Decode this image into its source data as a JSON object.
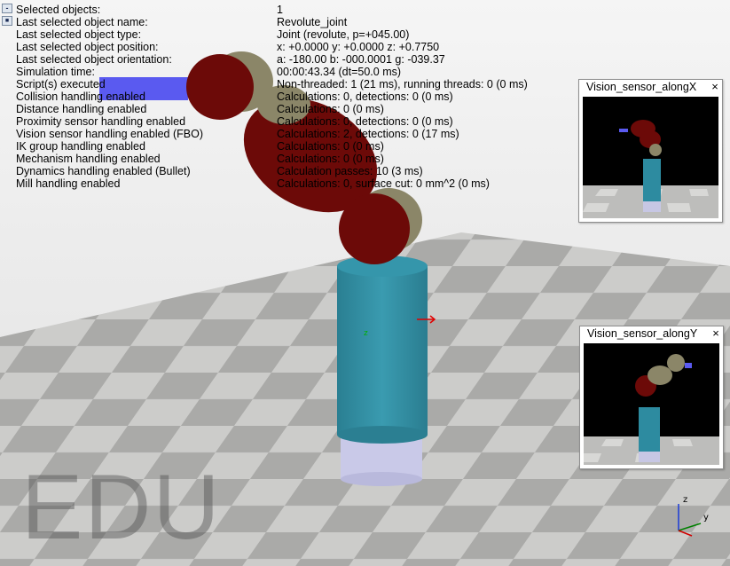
{
  "scene": {
    "watermark": "EDU",
    "gizmo": {
      "x_label": "y",
      "z_label": "z",
      "local_label": "z"
    },
    "colors": {
      "floor_light": "#c4c4c2",
      "floor_dark": "#9e9e9c",
      "base_cylinder": "#2f8a9e",
      "base_ring": "#c8c8e6",
      "joint_maroon": "#6e0a08",
      "joint_cap": "#8a8668",
      "sky": "#000000",
      "marker_blue": "#5858ee"
    }
  },
  "info": {
    "rows": [
      {
        "label": "Selected objects:",
        "value": "1"
      },
      {
        "label": "Last selected object name:",
        "value": "Revolute_joint"
      },
      {
        "label": "Last selected object type:",
        "value": "Joint (revolute, p=+045.00)"
      },
      {
        "label": "Last selected object position:",
        "value": "x: +0.0000    y: +0.0000    z: +0.7750"
      },
      {
        "label": "Last selected object orientation:",
        "value": "a: -180.00    b: -000.0001    g: -039.37"
      },
      {
        "label": "Simulation time:",
        "value": "00:00:43.34 (dt=50.0 ms)"
      },
      {
        "label": "Script(s) executed",
        "value": "Non-threaded: 1 (21 ms), running threads: 0 (0 ms)"
      },
      {
        "label": "Collision handling enabled",
        "value": "Calculations: 0, detections: 0 (0 ms)"
      },
      {
        "label": "Distance handling enabled",
        "value": "Calculations: 0 (0 ms)"
      },
      {
        "label": "Proximity sensor handling enabled",
        "value": "Calculations: 0, detections: 0 (0 ms)"
      },
      {
        "label": "Vision sensor handling enabled (FBO)",
        "value": "Calculations: 2, detections: 0 (17 ms)"
      },
      {
        "label": "IK group handling enabled",
        "value": "Calculations: 0 (0 ms)"
      },
      {
        "label": "Mechanism handling enabled",
        "value": "Calculations: 0 (0 ms)"
      },
      {
        "label": "Dynamics handling enabled (Bullet)",
        "value": "Calculation passes: 10 (3 ms)"
      },
      {
        "label": "Mill handling enabled",
        "value": "Calculations: 0, surface cut: 0 mm^2 (0 ms)"
      }
    ],
    "collapse_symbol": "-",
    "pin_symbol": "■"
  },
  "windows": [
    {
      "title": "Vision_sensor_alongX",
      "close": "×"
    },
    {
      "title": "Vision_sensor_alongY",
      "close": "×"
    }
  ]
}
